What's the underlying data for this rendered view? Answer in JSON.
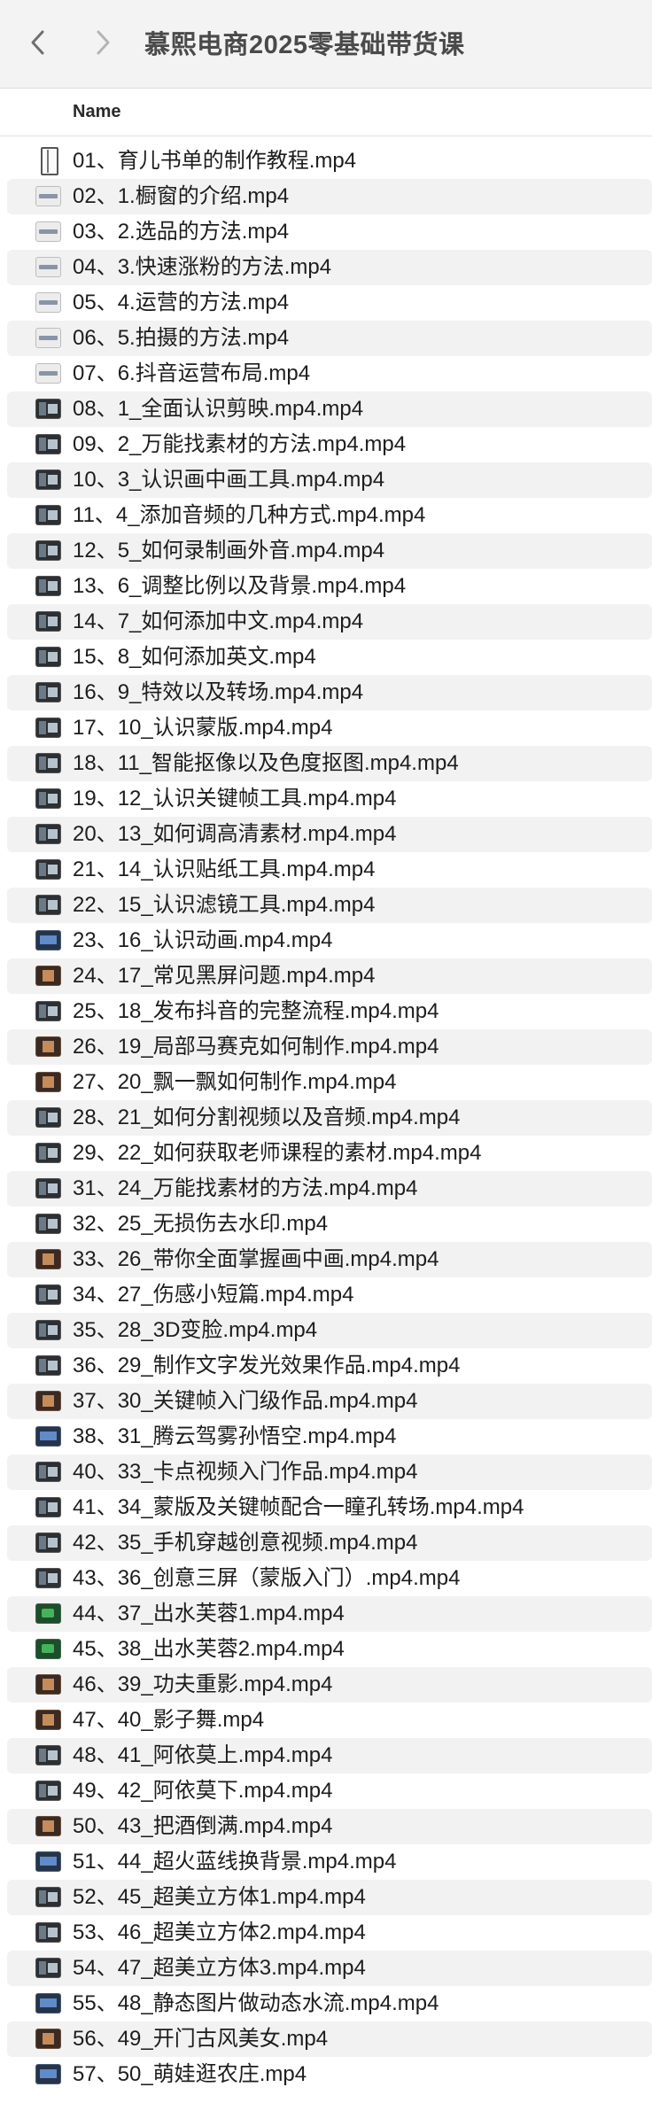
{
  "window": {
    "title": "慕熙电商2025零基础带货课"
  },
  "table": {
    "column_name": "Name"
  },
  "files": [
    {
      "name": "01、育儿书单的制作教程.mp4",
      "thumb": "first"
    },
    {
      "name": "02、1.橱窗的介绍.mp4",
      "thumb": "light"
    },
    {
      "name": "03、2.选品的方法.mp4",
      "thumb": "light"
    },
    {
      "name": "04、3.快速涨粉的方法.mp4",
      "thumb": "light"
    },
    {
      "name": "05、4.运营的方法.mp4",
      "thumb": "light"
    },
    {
      "name": "06、5.拍摄的方法.mp4",
      "thumb": "light"
    },
    {
      "name": "07、6.抖音运营布局.mp4",
      "thumb": "light"
    },
    {
      "name": "08、1_全面认识剪映.mp4.mp4",
      "thumb": "dark"
    },
    {
      "name": "09、2_万能找素材的方法.mp4.mp4",
      "thumb": "dark"
    },
    {
      "name": "10、3_认识画中画工具.mp4.mp4",
      "thumb": "dark"
    },
    {
      "name": "11、4_添加音频的几种方式.mp4.mp4",
      "thumb": "dark"
    },
    {
      "name": "12、5_如何录制画外音.mp4.mp4",
      "thumb": "dark"
    },
    {
      "name": "13、6_调整比例以及背景.mp4.mp4",
      "thumb": "dark"
    },
    {
      "name": "14、7_如何添加中文.mp4.mp4",
      "thumb": "dark"
    },
    {
      "name": "15、8_如何添加英文.mp4",
      "thumb": "dark"
    },
    {
      "name": "16、9_特效以及转场.mp4.mp4",
      "thumb": "dark"
    },
    {
      "name": "17、10_认识蒙版.mp4.mp4",
      "thumb": "dark"
    },
    {
      "name": "18、11_智能抠像以及色度抠图.mp4.mp4",
      "thumb": "dark"
    },
    {
      "name": "19、12_认识关键帧工具.mp4.mp4",
      "thumb": "dark"
    },
    {
      "name": "20、13_如何调高清素材.mp4.mp4",
      "thumb": "dark"
    },
    {
      "name": "21、14_认识贴纸工具.mp4.mp4",
      "thumb": "dark"
    },
    {
      "name": "22、15_认识滤镜工具.mp4.mp4",
      "thumb": "dark"
    },
    {
      "name": "23、16_认识动画.mp4.mp4",
      "thumb": "blue"
    },
    {
      "name": "24、17_常见黑屏问题.mp4.mp4",
      "thumb": "warm"
    },
    {
      "name": "25、18_发布抖音的完整流程.mp4.mp4",
      "thumb": "dark"
    },
    {
      "name": "26、19_局部马赛克如何制作.mp4.mp4",
      "thumb": "warm"
    },
    {
      "name": "27、20_飘一飘如何制作.mp4.mp4",
      "thumb": "warm"
    },
    {
      "name": "28、21_如何分割视频以及音频.mp4.mp4",
      "thumb": "dark"
    },
    {
      "name": "29、22_如何获取老师课程的素材.mp4.mp4",
      "thumb": "dark"
    },
    {
      "name": "31、24_万能找素材的方法.mp4.mp4",
      "thumb": "dark"
    },
    {
      "name": "32、25_无损伤去水印.mp4",
      "thumb": "dark"
    },
    {
      "name": "33、26_带你全面掌握画中画.mp4.mp4",
      "thumb": "warm"
    },
    {
      "name": "34、27_伤感小短篇.mp4.mp4",
      "thumb": "dark"
    },
    {
      "name": "35、28_3D变脸.mp4.mp4",
      "thumb": "dark"
    },
    {
      "name": "36、29_制作文字发光效果作品.mp4.mp4",
      "thumb": "dark"
    },
    {
      "name": "37、30_关键帧入门级作品.mp4.mp4",
      "thumb": "warm"
    },
    {
      "name": "38、31_腾云驾雾孙悟空.mp4.mp4",
      "thumb": "blue"
    },
    {
      "name": "40、33_卡点视频入门作品.mp4.mp4",
      "thumb": "dark"
    },
    {
      "name": "41、34_蒙版及关键帧配合一瞳孔转场.mp4.mp4",
      "thumb": "dark"
    },
    {
      "name": "42、35_手机穿越创意视频.mp4.mp4",
      "thumb": "dark"
    },
    {
      "name": "43、36_创意三屏（蒙版入门）.mp4.mp4",
      "thumb": "dark"
    },
    {
      "name": "44、37_出水芙蓉1.mp4.mp4",
      "thumb": "green"
    },
    {
      "name": "45、38_出水芙蓉2.mp4.mp4",
      "thumb": "green"
    },
    {
      "name": "46、39_功夫重影.mp4.mp4",
      "thumb": "warm"
    },
    {
      "name": "47、40_影子舞.mp4",
      "thumb": "warm"
    },
    {
      "name": "48、41_阿依莫上.mp4.mp4",
      "thumb": "dark"
    },
    {
      "name": "49、42_阿依莫下.mp4.mp4",
      "thumb": "dark"
    },
    {
      "name": "50、43_把酒倒满.mp4.mp4",
      "thumb": "warm"
    },
    {
      "name": "51、44_超火蓝线换背景.mp4.mp4",
      "thumb": "blue"
    },
    {
      "name": "52、45_超美立方体1.mp4.mp4",
      "thumb": "dark"
    },
    {
      "name": "53、46_超美立方体2.mp4.mp4",
      "thumb": "dark"
    },
    {
      "name": "54、47_超美立方体3.mp4.mp4",
      "thumb": "dark"
    },
    {
      "name": "55、48_静态图片做动态水流.mp4.mp4",
      "thumb": "blue"
    },
    {
      "name": "56、49_开门古风美女.mp4",
      "thumb": "warm"
    },
    {
      "name": "57、50_萌娃逛农庄.mp4",
      "thumb": "blue"
    }
  ]
}
